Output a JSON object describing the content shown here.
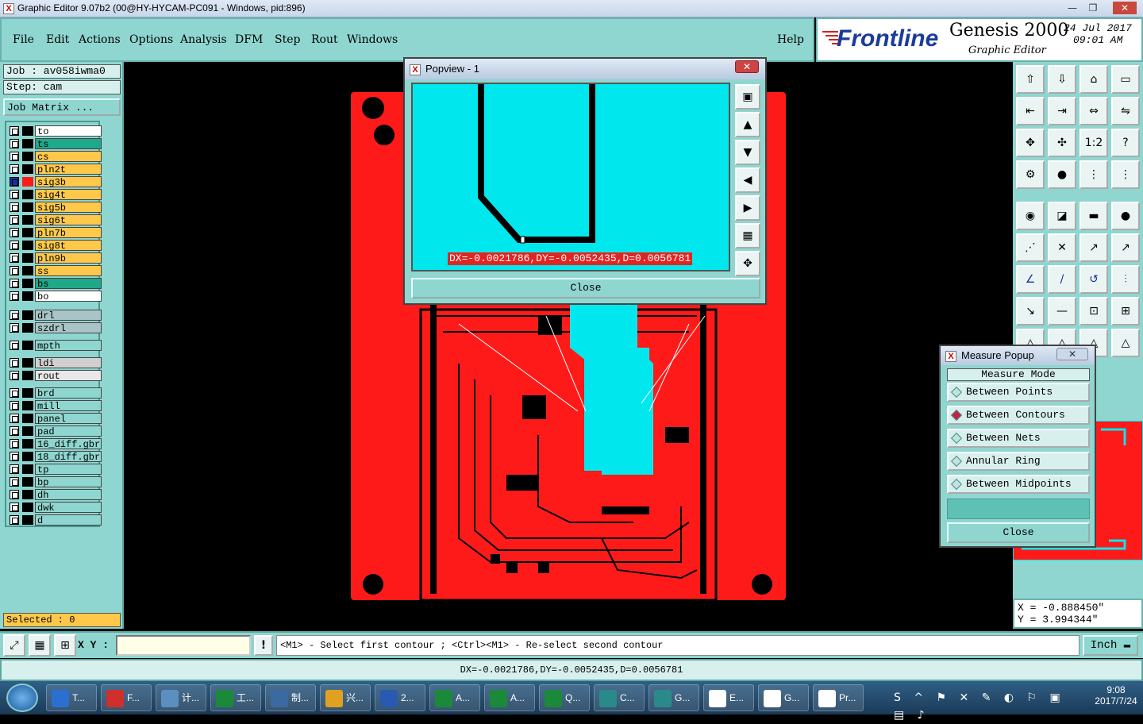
{
  "window": {
    "title": "Graphic Editor 9.07b2 (00@HY-HYCAM-PC091 - Windows, pid:896)",
    "app_icon": "X"
  },
  "menu": {
    "items": [
      "File",
      "Edit",
      "Actions",
      "Options",
      "Analysis",
      "DFM",
      "Step",
      "Rout",
      "Windows"
    ],
    "help": "Help"
  },
  "brand": {
    "logo": "Frontline",
    "product": "Genesis 2000",
    "subtitle": "Graphic Editor",
    "date": "24 Jul 2017",
    "time": "09:01 AM"
  },
  "job": {
    "job_label": "Job : av058iwma0",
    "step_label": "Step: cam",
    "matrix_button": "Job Matrix ..."
  },
  "layers": [
    {
      "name": "to",
      "color": "#ffffff"
    },
    {
      "name": "ts",
      "color": "#1fa88a"
    },
    {
      "name": "cs",
      "color": "#ffc84a"
    },
    {
      "name": "pln2t",
      "color": "#ffc84a"
    },
    {
      "name": "sig3b",
      "color": "#ffc84a",
      "active": true
    },
    {
      "name": "sig4t",
      "color": "#ffc84a"
    },
    {
      "name": "sig5b",
      "color": "#ffc84a"
    },
    {
      "name": "sig6t",
      "color": "#ffc84a"
    },
    {
      "name": "pln7b",
      "color": "#ffc84a"
    },
    {
      "name": "sig8t",
      "color": "#ffc84a"
    },
    {
      "name": "pln9b",
      "color": "#ffc84a"
    },
    {
      "name": "ss",
      "color": "#ffc84a"
    },
    {
      "name": "bs",
      "color": "#1fa88a"
    },
    {
      "name": "bo",
      "color": "#ffffff"
    },
    {
      "name": "drl",
      "color": "#a8c4c6"
    },
    {
      "name": "szdrl",
      "color": "#a8c4c6"
    },
    {
      "name": "mpth",
      "color": "#8fd6d0"
    },
    {
      "name": "ldi",
      "color": "#d0d0d0"
    },
    {
      "name": "rout",
      "color": "#e8e8e8"
    },
    {
      "name": "brd",
      "color": "#8fd6d0"
    },
    {
      "name": "mill",
      "color": "#8fd6d0"
    },
    {
      "name": "panel",
      "color": "#8fd6d0"
    },
    {
      "name": "pad",
      "color": "#8fd6d0"
    },
    {
      "name": "16_diff.gbr",
      "color": "#8fd6d0"
    },
    {
      "name": "18_diff.gbr",
      "color": "#8fd6d0"
    },
    {
      "name": "tp",
      "color": "#8fd6d0"
    },
    {
      "name": "bp",
      "color": "#8fd6d0"
    },
    {
      "name": "dh",
      "color": "#8fd6d0"
    },
    {
      "name": "dwk",
      "color": "#8fd6d0"
    },
    {
      "name": "d",
      "color": "#8fd6d0"
    }
  ],
  "selected": "Selected : 0",
  "popview": {
    "title": "Popview - 1",
    "measure_text": "DX=-0.0021786,DY=-0.0052435,D=0.0056781",
    "close": "Close"
  },
  "measure_popup": {
    "title": "Measure Popup",
    "heading": "Measure Mode",
    "options": [
      "Between Points",
      "Between Contours",
      "Between Nets",
      "Annular Ring",
      "Between Midpoints"
    ],
    "selected": "Between Contours",
    "close": "Close"
  },
  "coords": {
    "x": "X = -0.888450\"",
    "y": "Y = 3.994344\""
  },
  "command": {
    "xy_label": "X Y :",
    "prompt": "<M1> - Select first contour ; <Ctrl><M1> - Re-select second contour",
    "units": "Inch"
  },
  "bottom_status": "DX=-0.0021786,DY=-0.0052435,D=0.0056781",
  "taskbar": {
    "items": [
      "T...",
      "F...",
      "计...",
      "工...",
      "制...",
      "兴...",
      "2...",
      "A...",
      "A...",
      "Q...",
      "C...",
      "G...",
      "E...",
      "G...",
      "Pr..."
    ],
    "time": "9:08",
    "date": "2017/7/24"
  },
  "colors": {
    "board": "#ff1a1a",
    "highlight": "#00e8ee",
    "panel": "#8fd6d0"
  }
}
